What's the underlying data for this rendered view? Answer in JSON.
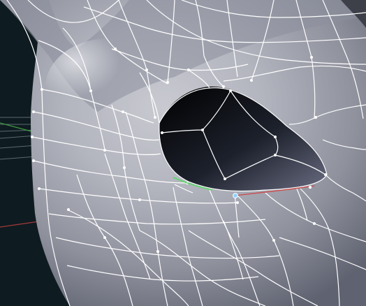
{
  "viewport": {
    "background_color": "#0e1b20",
    "grid_color": "#5b6a72",
    "axis_x_color": "#a43a3a",
    "axis_y_color": "#3f9a3f",
    "mesh_body_color": "#9a9ca8",
    "wireframe_color": "#ffffff",
    "eye_socket_color": "#0b0d12",
    "selected_vertex_color": "#8fd2ff",
    "selected_edge_color": "#5fd86a"
  },
  "icons": {
    "grid": "floor-grid-icon",
    "mesh": "mesh-object-icon",
    "vertex": "selected-vertex-icon"
  }
}
